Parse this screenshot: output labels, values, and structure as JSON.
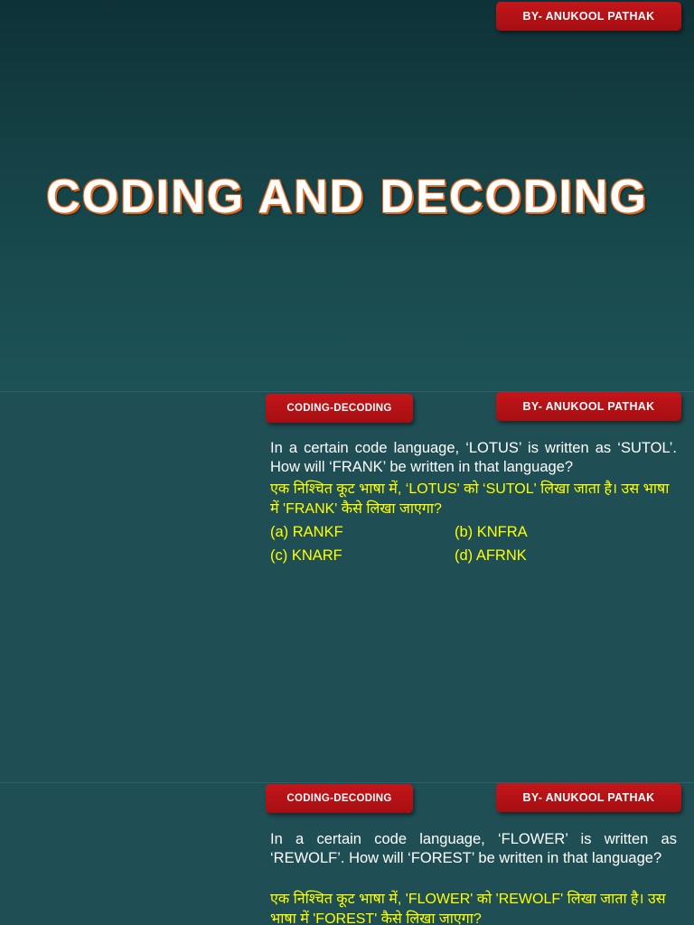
{
  "author": "BY- ANUKOOL PATHAK",
  "category": "CODING-DECODING",
  "title": "CODING AND DECODING",
  "questions": [
    {
      "english": "In a certain code language, ‘LOTUS’ is written as ‘SUTOL’. How will ‘FRANK’ be written in that language?",
      "hindi": "एक निश्चित कूट भाषा में, ‘LOTUS' को ‘SUTOL' लिखा जाता है। उस भाषा में 'FRANK' कैसे लिखा जाएगा?",
      "options": [
        "(a) RANKF",
        "(b) KNFRA",
        "(c) KNARF",
        "(d) AFRNK"
      ]
    },
    {
      "english": "In a certain code language, ‘FLOWER’ is written as ‘REWOLF’. How will ‘FOREST’ be written in that language?",
      "hindi": "एक निश्चित कूट भाषा में, 'FLOWER' को 'REWOLF' लिखा जाता है। उस भाषा में 'FOREST' कैसे लिखा जाएगा?"
    }
  ]
}
